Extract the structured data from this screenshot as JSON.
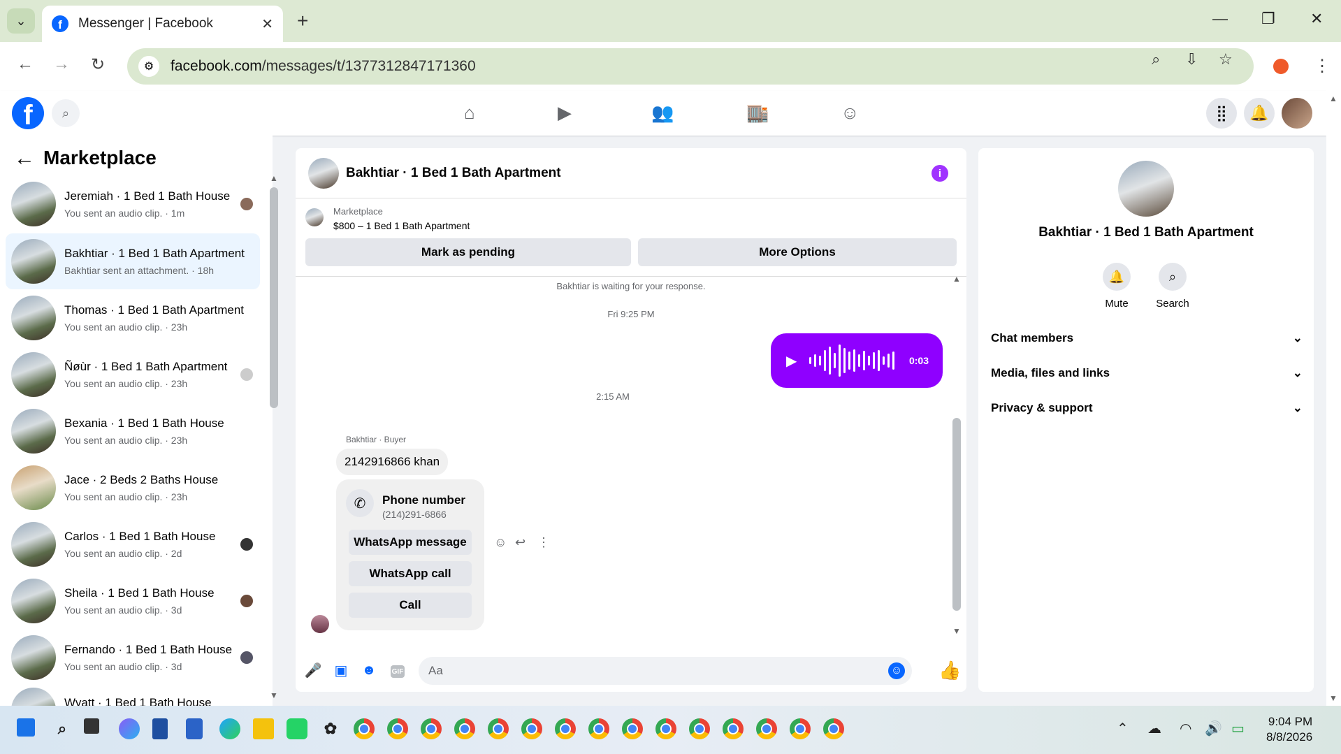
{
  "browser": {
    "tab_title": "Messenger | Facebook",
    "url_host": "facebook.com",
    "url_path": "/messages/t/1377312847171360"
  },
  "sidebar": {
    "title": "Marketplace",
    "conversations": [
      {
        "name": "Jeremiah · 1 Bed 1 Bath House",
        "preview": "You sent an audio clip. · 1m"
      },
      {
        "name": "Bakhtiar · 1 Bed 1 Bath Apartment",
        "preview": "Bakhtiar sent an attachment. · 18h"
      },
      {
        "name": "Thomas · 1 Bed 1 Bath Apartment",
        "preview": "You sent an audio clip. · 23h"
      },
      {
        "name": "Ñøùr · 1 Bed 1 Bath Apartment",
        "preview": "You sent an audio clip. · 23h"
      },
      {
        "name": "Bexania · 1 Bed 1 Bath House",
        "preview": "You sent an audio clip. · 23h"
      },
      {
        "name": "Jace · 2 Beds 2 Baths House",
        "preview": "You sent an audio clip. · 23h"
      },
      {
        "name": "Carlos · 1 Bed 1 Bath House",
        "preview": "You sent an audio clip. · 2d"
      },
      {
        "name": "Sheila · 1 Bed 1 Bath House",
        "preview": "You sent an audio clip. · 3d"
      },
      {
        "name": "Fernando · 1 Bed 1 Bath House",
        "preview": "You sent an audio clip. · 3d"
      },
      {
        "name": "Wyatt · 1 Bed 1 Bath House",
        "preview": ""
      }
    ]
  },
  "chat": {
    "title": "Bakhtiar · 1 Bed 1 Bath Apartment",
    "marketplace_label": "Marketplace",
    "listing": "$800 – 1 Bed 1 Bath Apartment",
    "mark_pending": "Mark as pending",
    "more_options": "More Options",
    "waiting": "Bakhtiar is waiting for your response.",
    "time1": "Fri 9:25 PM",
    "audio_duration": "0:03",
    "time2": "2:15 AM",
    "sender": "Bakhtiar · Buyer",
    "message": "2142916866 khan",
    "phone_title": "Phone number",
    "phone_number": "(214)291-6866",
    "whatsapp_message": "WhatsApp message",
    "whatsapp_call": "WhatsApp call",
    "call": "Call",
    "input_placeholder": "Aa"
  },
  "details": {
    "name": "Bakhtiar · 1 Bed 1 Bath Apartment",
    "mute": "Mute",
    "search": "Search",
    "sections": [
      "Chat members",
      "Media, files and links",
      "Privacy & support"
    ]
  },
  "taskbar": {
    "time": "9:04 PM",
    "date": "8/8/2026"
  },
  "colors": {
    "accent": "#0866ff",
    "audio_bubble": "#8f00ff"
  }
}
